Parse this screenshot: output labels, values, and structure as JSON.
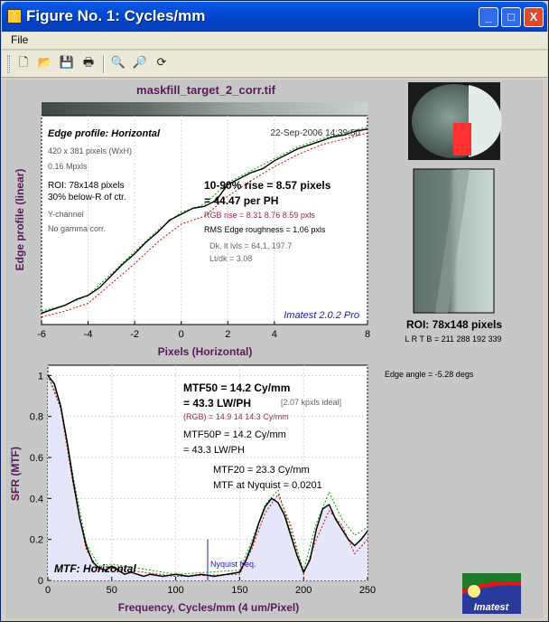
{
  "window": {
    "title": "Figure No. 1: Cycles/mm",
    "controls": {
      "minimize": "_",
      "maximize": "□",
      "close": "X"
    }
  },
  "menu": {
    "file": "File"
  },
  "toolbar": {
    "icons": [
      "new-file-icon",
      "open-folder-icon",
      "save-icon",
      "print-icon",
      "zoom-in-icon",
      "zoom-out-icon",
      "rotate-icon"
    ]
  },
  "colors": {
    "title_purple": "#5a1a5a",
    "rgb_text": "#9b2850",
    "blue_text": "#1c1cb4",
    "area_fill": "#e6e6fa",
    "green": "#00a000",
    "red": "#e00000",
    "roi_marker": "#ff3030"
  },
  "edge_plot": {
    "file_title": "maskfill_target_2_corr.tif",
    "heading": "Edge profile: Horizontal",
    "timestamp": "22-Sep-2006 14:39:50",
    "info": [
      "420 x 381 pixels (WxH)",
      "0.16 Mpxls",
      "ROI: 78x148 pixels",
      "30% below-R of ctr.",
      "Y-channel",
      "No gamma corr."
    ],
    "rise_line1": "10-90% rise = 8.57 pixels",
    "rise_line2": "= 44.47 per PH",
    "rgb_rise": "RGB rise = 8.31  8.76  8.59 pxls",
    "rms": "RMS Edge roughness = 1.06 pxls",
    "dk_lt": "Dk, lt lvls = 64.1, 197.7",
    "ratio": "Lt/dk = 3.08",
    "watermark": "Imatest 2.0.2 Pro",
    "xlabel": "Pixels (Horizontal)",
    "ylabel": "Edge profile (linear)"
  },
  "mtf_plot": {
    "mtf50_line1": "MTF50 = 14.2 Cy/mm",
    "mtf50_line2": "= 43.3 LW/PH",
    "ideal": "[2.07 kpxls ideal]",
    "rgb": "(RGB) = 14.9  14  14.3 Cy/mm",
    "mtf50p_line1": "MTF50P = 14.2 Cy/mm",
    "mtf50p_line2": "= 43.3 LW/PH",
    "mtf20": "MTF20 = 23.3 Cy/mm",
    "nyquist_mtf": "MTF at Nyquist = 0.0201",
    "nyquist_label": "Nyquist freq.",
    "corner_label": "MTF: Horizontal",
    "xlabel": "Frequency, Cycles/mm  (4 um/Pixel)",
    "ylabel": "SFR (MTF)"
  },
  "roi_panel": {
    "label": "ROI: 78x148 pixels",
    "coords": "L R T B = 211 288  192 339",
    "edge_angle": "Edge angle = -5.28 degs"
  },
  "logo": {
    "text": "Imatest"
  },
  "chart_data": [
    {
      "type": "line",
      "title": "Edge profile: Horizontal",
      "xlabel": "Pixels (Horizontal)",
      "ylabel": "Edge profile (linear)",
      "xlim": [
        -6,
        8
      ],
      "ylim": [
        0,
        1
      ],
      "x_ticks": [
        "-6",
        "-4",
        "-2",
        "0",
        "2",
        "4",
        "8"
      ],
      "x_tick_values": [
        -6,
        -4,
        -2,
        0,
        2,
        4,
        8
      ],
      "grid": true,
      "series": [
        {
          "name": "Y",
          "color": "#000000",
          "x": [
            -6,
            -5.5,
            -5,
            -4.5,
            -4,
            -3.5,
            -3,
            -2.5,
            -2,
            -1.5,
            -1,
            -0.5,
            0,
            0.5,
            1,
            1.5,
            2,
            2.5,
            3,
            3.5,
            4,
            4.5,
            5,
            5.5,
            6,
            6.5,
            7,
            7.5,
            8
          ],
          "y": [
            0.03,
            0.05,
            0.07,
            0.1,
            0.12,
            0.16,
            0.22,
            0.28,
            0.33,
            0.39,
            0.44,
            0.5,
            0.53,
            0.56,
            0.57,
            0.6,
            0.68,
            0.71,
            0.74,
            0.76,
            0.8,
            0.83,
            0.86,
            0.88,
            0.9,
            0.92,
            0.93,
            0.95,
            0.96
          ]
        },
        {
          "name": "R",
          "color": "#e00000",
          "x": [
            -6,
            -5,
            -4,
            -3,
            -2,
            -1,
            0,
            1,
            2,
            3,
            4,
            5,
            6,
            7,
            8
          ],
          "y": [
            0.01,
            0.04,
            0.08,
            0.18,
            0.28,
            0.39,
            0.48,
            0.52,
            0.62,
            0.7,
            0.77,
            0.83,
            0.88,
            0.91,
            0.94
          ]
        },
        {
          "name": "G",
          "color": "#00a000",
          "x": [
            -6,
            -5,
            -4,
            -3,
            -2,
            -1,
            0,
            1,
            2,
            3,
            4,
            5,
            6,
            7,
            8
          ],
          "y": [
            0.04,
            0.07,
            0.12,
            0.23,
            0.34,
            0.45,
            0.54,
            0.58,
            0.69,
            0.75,
            0.81,
            0.87,
            0.91,
            0.94,
            0.97
          ]
        }
      ]
    },
    {
      "type": "area",
      "title": "MTF: Horizontal",
      "xlabel": "Frequency, Cycles/mm  (4 um/Pixel)",
      "ylabel": "SFR (MTF)",
      "xlim": [
        0,
        250
      ],
      "ylim": [
        0,
        1.05
      ],
      "x_ticks": [
        "0",
        "50",
        "100",
        "150",
        "200",
        "250"
      ],
      "x_tick_values": [
        0,
        50,
        100,
        150,
        200,
        250
      ],
      "y_ticks": [
        "0",
        "0.2",
        "0.4",
        "0.6",
        "0.8",
        "1"
      ],
      "y_tick_values": [
        0,
        0.2,
        0.4,
        0.6,
        0.8,
        1
      ],
      "grid": true,
      "nyquist_x": 125,
      "nyquist_y": 0.2,
      "series": [
        {
          "name": "Y",
          "color": "#000000",
          "x": [
            0,
            5,
            10,
            15,
            20,
            25,
            30,
            35,
            40,
            45,
            50,
            55,
            60,
            65,
            70,
            75,
            80,
            90,
            100,
            110,
            120,
            130,
            140,
            150,
            155,
            160,
            165,
            170,
            175,
            180,
            185,
            190,
            195,
            200,
            205,
            210,
            215,
            220,
            225,
            230,
            235,
            240,
            245,
            250
          ],
          "y": [
            1.0,
            0.96,
            0.85,
            0.68,
            0.48,
            0.3,
            0.17,
            0.09,
            0.06,
            0.05,
            0.07,
            0.05,
            0.03,
            0.04,
            0.03,
            0.02,
            0.03,
            0.02,
            0.03,
            0.02,
            0.03,
            0.02,
            0.03,
            0.04,
            0.1,
            0.18,
            0.28,
            0.36,
            0.4,
            0.38,
            0.32,
            0.22,
            0.12,
            0.04,
            0.1,
            0.25,
            0.35,
            0.37,
            0.3,
            0.25,
            0.2,
            0.17,
            0.2,
            0.24
          ]
        },
        {
          "name": "R",
          "color": "#e00000",
          "x": [
            0,
            10,
            20,
            30,
            40,
            50,
            100,
            150,
            160,
            170,
            180,
            190,
            200,
            210,
            220,
            230,
            240,
            250
          ],
          "y": [
            1.0,
            0.84,
            0.46,
            0.15,
            0.05,
            0.06,
            0.02,
            0.03,
            0.16,
            0.33,
            0.42,
            0.27,
            0.03,
            0.2,
            0.34,
            0.27,
            0.13,
            0.2
          ]
        },
        {
          "name": "G",
          "color": "#00a000",
          "x": [
            0,
            10,
            20,
            30,
            40,
            50,
            100,
            150,
            160,
            170,
            180,
            190,
            200,
            210,
            220,
            230,
            240,
            250
          ],
          "y": [
            1.0,
            0.86,
            0.5,
            0.18,
            0.07,
            0.08,
            0.03,
            0.05,
            0.2,
            0.37,
            0.44,
            0.24,
            0.05,
            0.28,
            0.43,
            0.3,
            0.22,
            0.26
          ]
        }
      ]
    }
  ]
}
